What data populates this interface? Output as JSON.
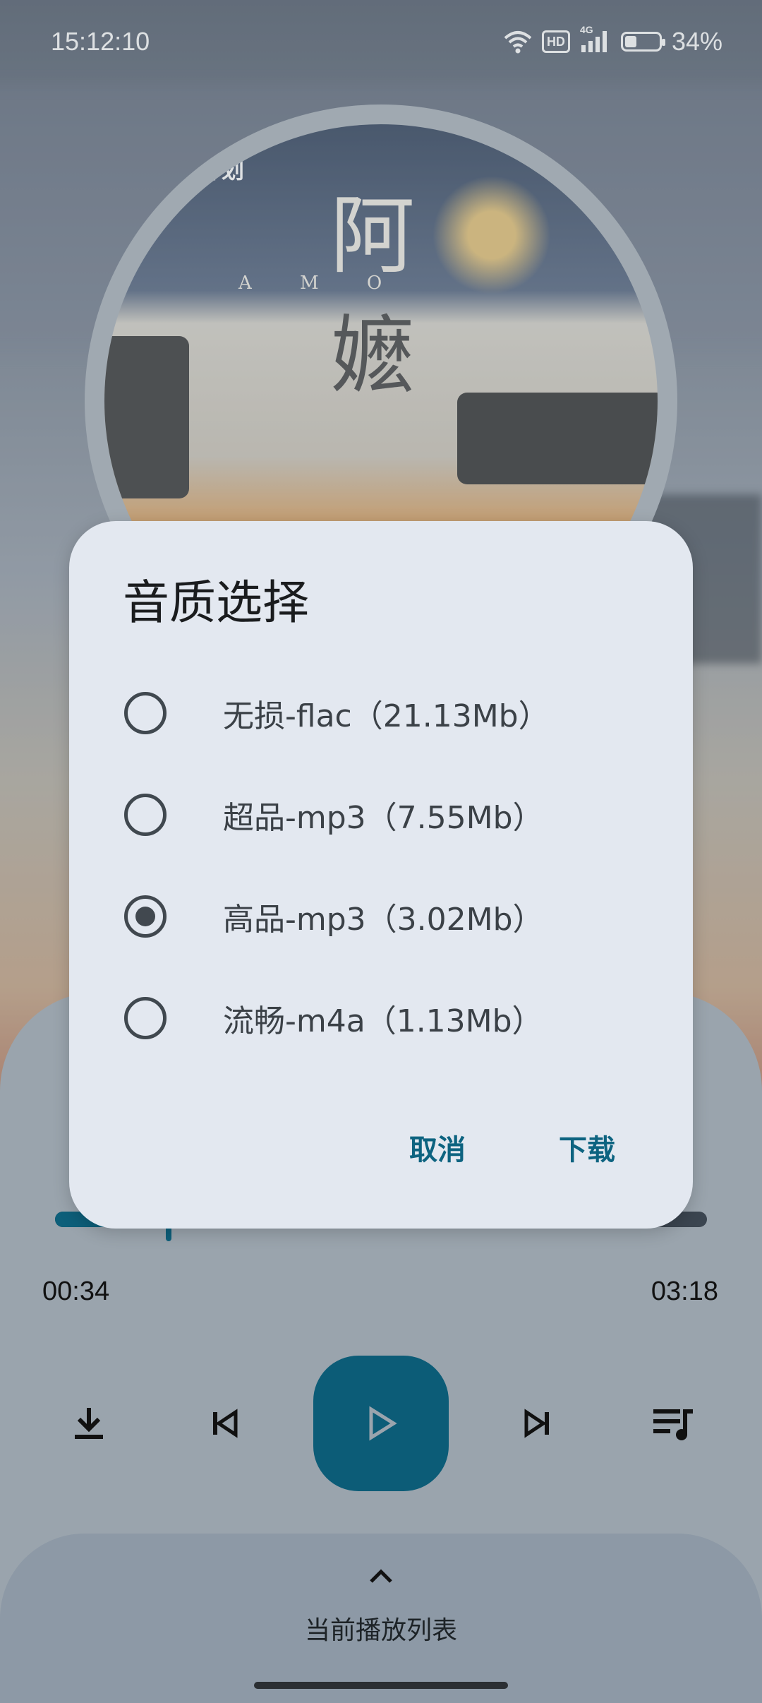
{
  "status_bar": {
    "time": "15:12:10",
    "battery_text": "34%",
    "battery_level": 0.34,
    "hd_label": "HD",
    "network_label": "4G",
    "icons": [
      "wifi-icon",
      "hd-icon",
      "signal-icon",
      "battery-icon"
    ]
  },
  "album": {
    "art_text_top": "银河计划",
    "art_text_main_1": "阿",
    "art_text_main_2": "嬷",
    "art_letters": "A  M  O"
  },
  "player": {
    "elapsed": "00:34",
    "duration": "03:18",
    "progress": 0.17,
    "controls": [
      "download-icon",
      "previous-icon",
      "play-icon",
      "next-icon",
      "queue-icon"
    ]
  },
  "playlist": {
    "label": "当前播放列表"
  },
  "dialog": {
    "title": "音质选择",
    "options": [
      {
        "label": "无损-flac（21.13Mb）",
        "selected": false
      },
      {
        "label": "超品-mp3（7.55Mb）",
        "selected": false
      },
      {
        "label": "高品-mp3（3.02Mb）",
        "selected": true
      },
      {
        "label": "流畅-m4a（1.13Mb）",
        "selected": false
      }
    ],
    "cancel_label": "取消",
    "confirm_label": "下载"
  },
  "colors": {
    "accent": "#0d6380",
    "play_button": "#0c5c77",
    "dialog_bg": "#e3e8f0"
  }
}
